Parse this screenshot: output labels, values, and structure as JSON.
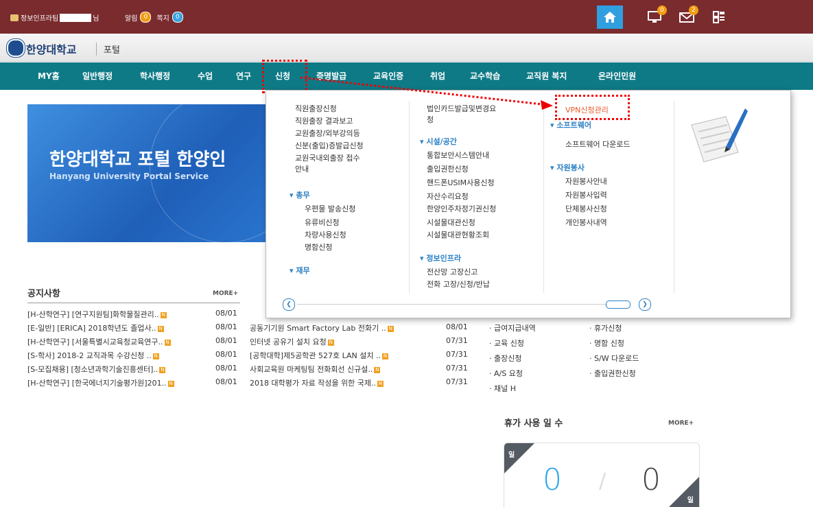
{
  "topbar": {
    "user_prefix": "정보인프라팀",
    "user_suffix": "님",
    "alarm_label": "알림",
    "alarm_count": "0",
    "memo_label": "쪽지",
    "memo_count": "0",
    "pc_badge": "0",
    "mail_badge": "2"
  },
  "logo": {
    "name": "한양대학교",
    "portal": "포털"
  },
  "nav": [
    "MY홈",
    "일반행정",
    "학사행정",
    "수업",
    "연구",
    "신청",
    "증명발급",
    "교육인증",
    "취업",
    "교수학습",
    "교직원 복지",
    "온라인민원"
  ],
  "banner": {
    "title": "한양대학교 포털 한양인",
    "subtitle": "Hanyang University Portal Service"
  },
  "dropdown": {
    "col1": [
      "직원출장신청",
      "직원출장 결과보고",
      "교원출장/외부강의등",
      "신분(출입)증발급신청",
      "교원국내외출장 접수",
      "안내"
    ],
    "col1_head2": "총무",
    "col1_b": [
      "우편물 발송신청",
      "유류비신청",
      "차량사용신청",
      "명함신청"
    ],
    "col1_head3": "재무",
    "col2_top": [
      "법인카드발급및변경요",
      "청"
    ],
    "col2_head1": "시설/공간",
    "col2_a": [
      "통합보안시스템안내",
      "출입권한신청",
      "핸드폰USIM사용신청",
      "자산수리요청",
      "한양인주차정기권신청",
      "시설물대관신청",
      "시설물대관현황조회"
    ],
    "col2_head2": "정보인프라",
    "col2_b": [
      "전산망 고장신고",
      "전화 고장/신청/반납"
    ],
    "col3_top": "VPN신청관리",
    "col3_head1": "소프트웨어",
    "col3_a": [
      "소프트웨어 다운로드"
    ],
    "col3_head2": "자원봉사",
    "col3_b": [
      "자원봉사안내",
      "자원봉사입력",
      "단체봉사신청",
      "개인봉사내역"
    ]
  },
  "notice": {
    "title": "공지사항",
    "more": "MORE+",
    "items": [
      {
        "text": "[H-산학연구] [연구지원팀]화학물질관리..",
        "date": "08/01"
      },
      {
        "text": "[E-일반] [ERICA] 2018학년도 졸업사..",
        "date": "08/01"
      },
      {
        "text": "[H-산학연구] [서울특별시교육청교육연구..",
        "date": "08/01"
      },
      {
        "text": "[S-학사] 2018-2 교직과목 수강신청 ..",
        "date": "08/01"
      },
      {
        "text": "[S-모집채용] [청소년과학기술진흥센터]..",
        "date": "08/01"
      },
      {
        "text": "[H-산학연구] [한국에너지기술평가원]201..",
        "date": "08/01"
      }
    ]
  },
  "mid_list": [
    {
      "text": "공동기기원 Smart Factory Lab 전화기 ..",
      "date": "08/01"
    },
    {
      "text": "인터넷 공유기 설치 요청",
      "date": "07/31"
    },
    {
      "text": "[공학대학]제5공학관 527호 LAN 설치 ..",
      "date": "07/31"
    },
    {
      "text": "사회교육원 마케팅팀 전화회선 신규설..",
      "date": "07/31"
    },
    {
      "text": "2018 대학평가 자료 작성을 위한 국제..",
      "date": "07/31"
    }
  ],
  "right_col1": [
    "급여지급내역",
    "교육 신청",
    "출장신청",
    "A/S 요청",
    "채널 H"
  ],
  "right_col2": [
    "휴가신청",
    "명함 신청",
    "S/W 다운로드",
    "출입권한신청"
  ],
  "vacation": {
    "title": "휴가 사용 일 수",
    "more": "MORE+",
    "used": "0",
    "remaining": "0",
    "unit": "일"
  },
  "colors": {
    "topbar": "#7a2b2e",
    "navbar": "#0e7a86",
    "highlight": "#e00000",
    "accent": "#2a7fc4"
  }
}
